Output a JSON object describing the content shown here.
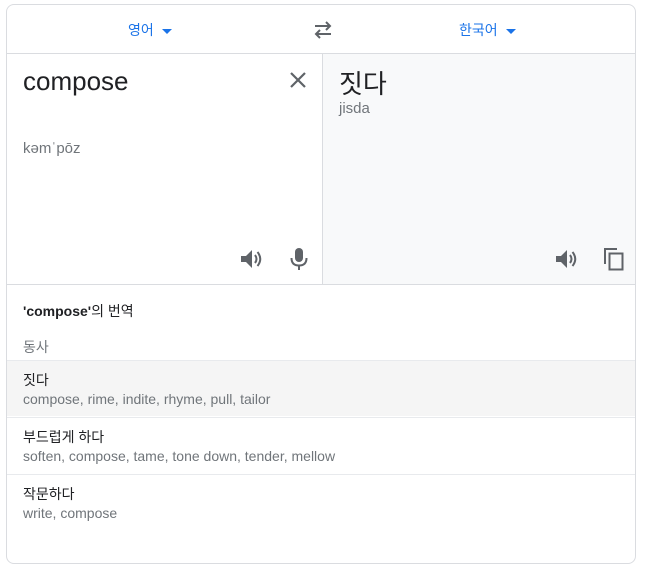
{
  "lang_bar": {
    "source_lang": "영어",
    "target_lang": "한국어"
  },
  "source": {
    "text": "compose",
    "phonetic": "kəmˈpōz"
  },
  "target": {
    "text": "짓다",
    "romanization": "jisda"
  },
  "dictionary": {
    "title_word": "'compose'",
    "title_suffix": "의 번역",
    "part_of_speech": "동사",
    "entries": [
      {
        "word": "짓다",
        "synonyms": "compose, rime, indite, rhyme, pull, tailor"
      },
      {
        "word": "부드럽게 하다",
        "synonyms": "soften, compose, tame, tone down, tender, mellow"
      },
      {
        "word": "작문하다",
        "synonyms": "write, compose"
      }
    ]
  },
  "colors": {
    "accent": "#1a73e8",
    "icon": "#5f6368",
    "target_bg": "#f8f9fa",
    "highlight_row": "#f5f5f5"
  }
}
